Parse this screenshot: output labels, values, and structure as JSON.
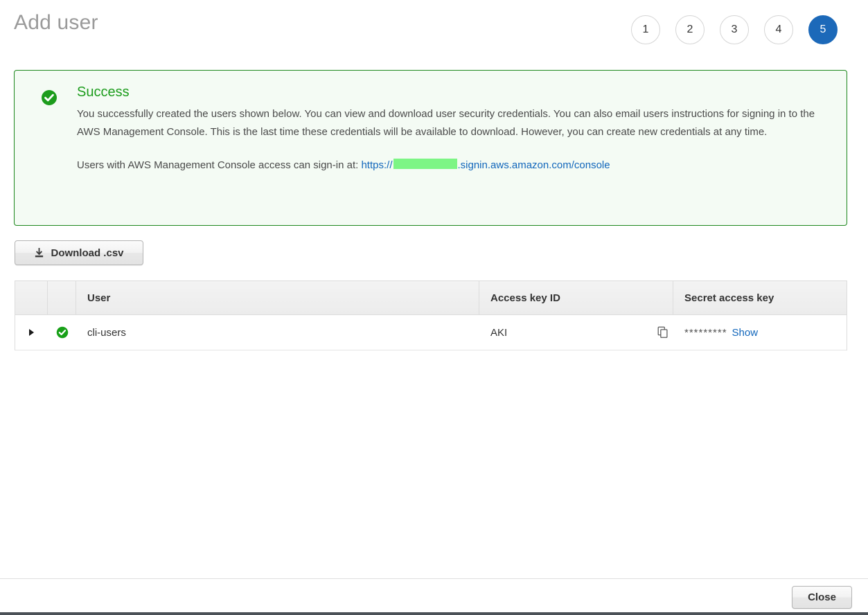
{
  "header": {
    "title": "Add user",
    "steps": [
      {
        "label": "1",
        "active": false
      },
      {
        "label": "2",
        "active": false
      },
      {
        "label": "3",
        "active": false
      },
      {
        "label": "4",
        "active": false
      },
      {
        "label": "5",
        "active": true
      }
    ],
    "active_step_color": "#1c69b9"
  },
  "success": {
    "icon": "check-circle-icon",
    "title": "Success",
    "title_color": "#1c9c1c",
    "border_color": "#1c871c",
    "background_color": "#f4fbf4",
    "body": "You successfully created the users shown below. You can view and download user security credentials. You can also email users instructions for signing in to the AWS Management Console. This is the last time these credentials will be available to download. However, you can create new credentials at any time.",
    "signin_prefix": "Users with AWS Management Console access can sign-in at:",
    "signin_url_start": "https://",
    "signin_url_redacted": "",
    "signin_url_end": ".signin.aws.amazon.com/console",
    "link_color": "#1166bb",
    "redaction_color": "#7df585"
  },
  "toolbar": {
    "download_label": "Download .csv",
    "download_icon": "download-icon"
  },
  "table": {
    "columns": [
      {
        "key": "expand",
        "label": ""
      },
      {
        "key": "status",
        "label": ""
      },
      {
        "key": "user",
        "label": "User"
      },
      {
        "key": "access_key_id",
        "label": "Access key ID"
      },
      {
        "key": "secret_access_key",
        "label": "Secret access key"
      }
    ],
    "rows": [
      {
        "expand_icon": "triangle-right-icon",
        "status_icon": "check-circle-icon",
        "user": "cli-users",
        "access_key_id": "AKI",
        "copy_icon": "copy-icon",
        "secret_access_key_masked": "*********",
        "show_label": "Show"
      }
    ]
  },
  "footer": {
    "close_label": "Close"
  }
}
